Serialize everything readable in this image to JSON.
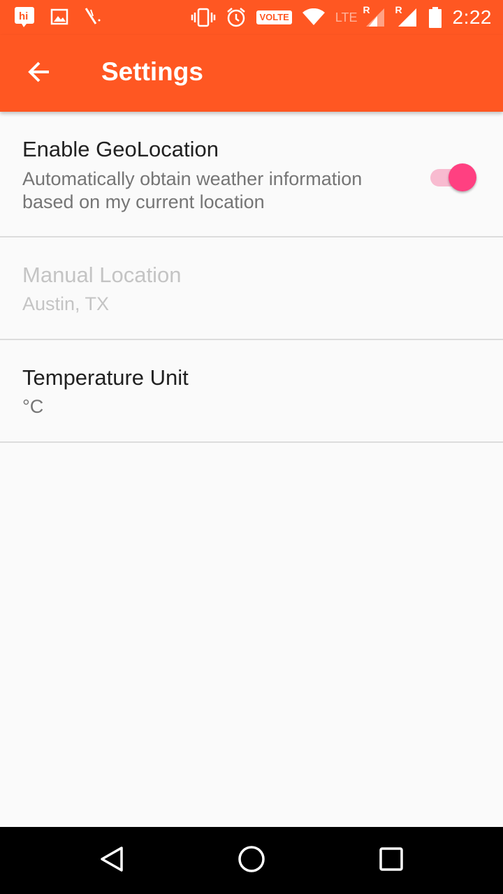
{
  "status_bar": {
    "time": "2:22",
    "volte": "VOLTE",
    "network": "LTE",
    "roaming_1": "R",
    "roaming_2": "R",
    "left_icons": [
      "hike-icon",
      "image-icon",
      "feather-icon"
    ],
    "right_icons": [
      "vibrate-icon",
      "alarm-icon",
      "volte-icon",
      "wifi-icon",
      "signal-icon",
      "signal-icon",
      "battery-icon"
    ]
  },
  "app_bar": {
    "title": "Settings",
    "back_icon": "arrow-back-icon",
    "color": "#ff5722"
  },
  "preferences": [
    {
      "title": "Enable GeoLocation",
      "summary": "Automatically obtain weather information based on my current location",
      "type": "switch",
      "checked": true,
      "enabled": true
    },
    {
      "title": "Manual Location",
      "summary": "Austin, TX",
      "type": "text",
      "enabled": false
    },
    {
      "title": "Temperature Unit",
      "summary": "°C",
      "type": "list",
      "enabled": true
    }
  ],
  "colors": {
    "accent": "#ff4081",
    "accent_track": "#f8bbd0",
    "primary": "#ff5722"
  },
  "nav_bar": {
    "icons": [
      "back-triangle-icon",
      "home-circle-icon",
      "recents-square-icon"
    ]
  }
}
